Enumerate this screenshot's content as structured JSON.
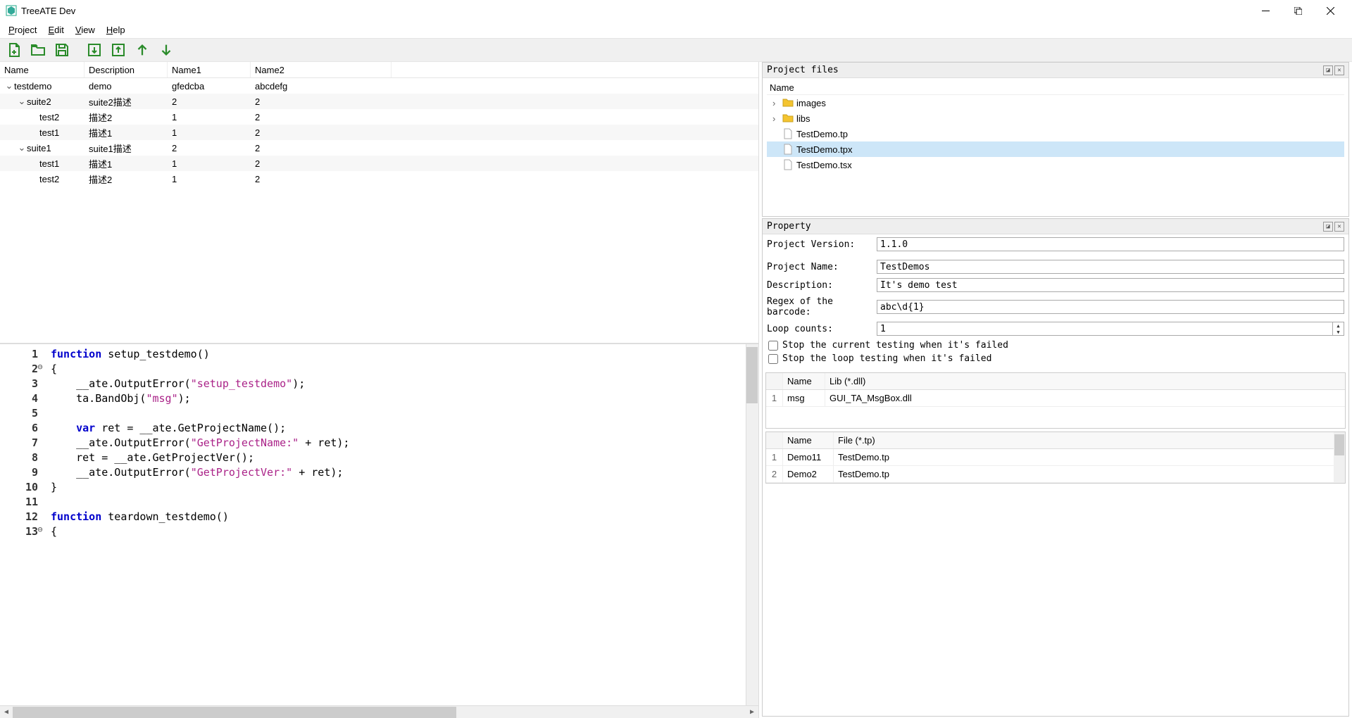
{
  "window": {
    "title": "TreeATE Dev"
  },
  "menu": {
    "project": "Project",
    "edit": "Edit",
    "view": "View",
    "help": "Help"
  },
  "treegrid": {
    "headers": [
      "Name",
      "Description",
      "Name1",
      "Name2"
    ],
    "rows": [
      {
        "indent": 0,
        "exp": "v",
        "name": "testdemo",
        "desc": "demo",
        "n1": "gfedcba",
        "n2": "abcdefg"
      },
      {
        "indent": 1,
        "exp": "v",
        "name": "suite2",
        "desc": "suite2描述",
        "n1": "2",
        "n2": "2"
      },
      {
        "indent": 2,
        "exp": "",
        "name": "test2",
        "desc": "描述2",
        "n1": "1",
        "n2": "2"
      },
      {
        "indent": 2,
        "exp": "",
        "name": "test1",
        "desc": "描述1",
        "n1": "1",
        "n2": "2"
      },
      {
        "indent": 1,
        "exp": "v",
        "name": "suite1",
        "desc": "suite1描述",
        "n1": "2",
        "n2": "2"
      },
      {
        "indent": 2,
        "exp": "",
        "name": "test1",
        "desc": "描述1",
        "n1": "1",
        "n2": "2"
      },
      {
        "indent": 2,
        "exp": "",
        "name": "test2",
        "desc": "描述2",
        "n1": "1",
        "n2": "2"
      }
    ]
  },
  "code": {
    "lines": [
      {
        "n": 1,
        "fold": "",
        "html": "<span class='kw'>function</span> setup_testdemo()"
      },
      {
        "n": 2,
        "fold": "⊖",
        "html": "{"
      },
      {
        "n": 3,
        "fold": "",
        "html": "    __ate.OutputError(<span class='str'>\"setup_testdemo\"</span>);"
      },
      {
        "n": 4,
        "fold": "",
        "html": "    ta.BandObj(<span class='str'>\"msg\"</span>);"
      },
      {
        "n": 5,
        "fold": "",
        "html": ""
      },
      {
        "n": 6,
        "fold": "",
        "html": "    <span class='kw'>var</span> ret = __ate.GetProjectName();"
      },
      {
        "n": 7,
        "fold": "",
        "html": "    __ate.OutputError(<span class='str'>\"GetProjectName:\"</span> + ret);"
      },
      {
        "n": 8,
        "fold": "",
        "html": "    ret = __ate.GetProjectVer();"
      },
      {
        "n": 9,
        "fold": "",
        "html": "    __ate.OutputError(<span class='str'>\"GetProjectVer:\"</span> + ret);"
      },
      {
        "n": 10,
        "fold": "",
        "html": "}"
      },
      {
        "n": 11,
        "fold": "",
        "html": ""
      },
      {
        "n": 12,
        "fold": "",
        "html": "<span class='kw'>function</span> teardown_testdemo()"
      },
      {
        "n": 13,
        "fold": "⊖",
        "html": "{"
      }
    ]
  },
  "projectfiles": {
    "title": "Project files",
    "header": "Name",
    "items": [
      {
        "indent": 0,
        "exp": ">",
        "icon": "folder",
        "name": "images"
      },
      {
        "indent": 0,
        "exp": ">",
        "icon": "folder",
        "name": "libs"
      },
      {
        "indent": 0,
        "exp": "",
        "icon": "file",
        "name": "TestDemo.tp"
      },
      {
        "indent": 0,
        "exp": "",
        "icon": "file",
        "name": "TestDemo.tpx",
        "sel": true
      },
      {
        "indent": 0,
        "exp": "",
        "icon": "file",
        "name": "TestDemo.tsx"
      }
    ]
  },
  "property": {
    "title": "Property",
    "version_label": "Project Version:",
    "version": "1.1.0",
    "name_label": "Project Name:",
    "name": "TestDemos",
    "desc_label": "Description:",
    "desc": "It's demo test",
    "regex_label": "Regex of the barcode:",
    "regex": "abc\\d{1}",
    "loop_label": "Loop counts:",
    "loop": "1",
    "stop_current": "Stop the current testing when it's failed",
    "stop_loop": "Stop the loop testing when it's failed"
  },
  "libtable": {
    "headers": [
      "Name",
      "Lib (*.dll)"
    ],
    "rows": [
      {
        "n": "1",
        "name": "msg",
        "file": "GUI_TA_MsgBox.dll"
      }
    ]
  },
  "tptable": {
    "headers": [
      "Name",
      "File (*.tp)"
    ],
    "rows": [
      {
        "n": "1",
        "name": "Demo11",
        "file": "TestDemo.tp"
      },
      {
        "n": "2",
        "name": "Demo2",
        "file": "TestDemo.tp"
      }
    ]
  }
}
